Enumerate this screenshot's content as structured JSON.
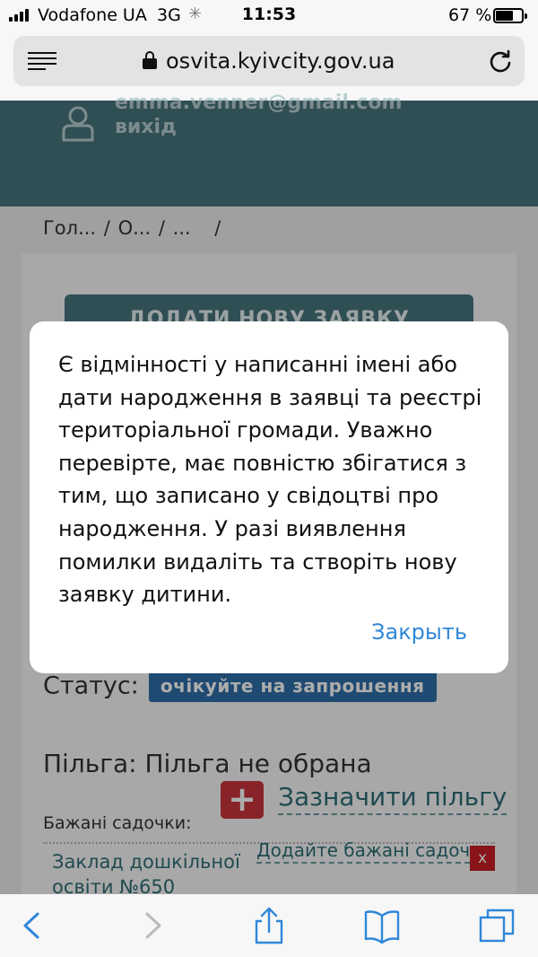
{
  "status_bar": {
    "carrier": "Vodafone UA",
    "network": "3G",
    "time": "11:53",
    "battery": "67 %",
    "battery_level": 0.67
  },
  "browser": {
    "url": "osvita.kyivcity.gov.ua",
    "menu_icon": "reader-menu-icon",
    "lock_icon": "lock-icon",
    "reload_icon": "reload-icon"
  },
  "header": {
    "email": "emma.venner@gmail.com",
    "logout": "вихід",
    "user_icon": "user-icon"
  },
  "breadcrumb": {
    "items": [
      "Гол...",
      "О...",
      "..."
    ],
    "separator": "/"
  },
  "page": {
    "add_application_button": "ДОДАТИ НОВУ ЗАЯВКУ",
    "status_label": "Статус:",
    "status_value": "очікуйте на запрошення",
    "benefit_label": "Пільга:",
    "benefit_value": "Пільга не обрана",
    "add_benefit_icon": "+",
    "set_benefit_link": "Зазначити пільгу",
    "kindergartens_label": "Бажані садочки:",
    "kindergarten_item": "Заклад дошкільної освіти №650",
    "add_kindergarten_link": "Додайте бажані садочки",
    "remove_label": "x"
  },
  "dialog": {
    "message": "Є відмінності у написанні імені або дати народження в заявці та реєстрі територіальної громади. Уважно перевірте, має повністю збігатися з тим, що записано у свідоцтві про народження. У разі виявлення помилки видаліть та створіть нову заявку дитини.",
    "close_button": "Закрыть"
  },
  "toolbar": {
    "icons": [
      "back-icon",
      "forward-icon",
      "share-icon",
      "bookmarks-icon",
      "tabs-icon"
    ]
  },
  "colors": {
    "header_teal": "#47757c",
    "link_blue": "#2f87d9",
    "badge_blue": "#2f6ea8",
    "danger_red": "#c9353d"
  }
}
